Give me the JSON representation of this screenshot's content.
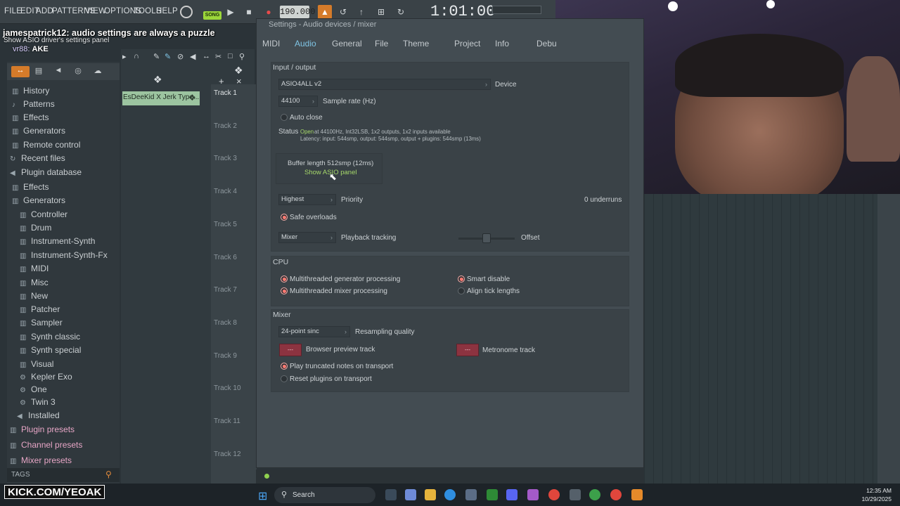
{
  "menu": [
    "FILE",
    "EDIT",
    "ADD",
    "PATTERNS",
    "VIEW",
    "OPTIONS",
    "TOOLS",
    "HELP"
  ],
  "transport": {
    "song_label": "SONG",
    "tempo": "190.000",
    "time": "1:01:00"
  },
  "chat": {
    "user": "jamespatrick12:",
    "message": "audio settings are always a puzzle",
    "second_user": "vr88:",
    "second_message": "AKE",
    "hint": "Show ASIO driver's settings panel"
  },
  "browser": {
    "items": [
      {
        "label": "History",
        "icon": "history-icon"
      },
      {
        "label": "Patterns",
        "icon": "note-icon"
      },
      {
        "label": "Effects",
        "icon": "speaker-icon"
      },
      {
        "label": "Generators",
        "icon": "piano-icon"
      },
      {
        "label": "Remote control",
        "icon": "remote-icon"
      },
      {
        "label": "Recent files",
        "icon": "refresh-icon"
      },
      {
        "label": "Plugin database",
        "icon": "plug-icon"
      },
      {
        "label": "Effects",
        "icon": "piano-icon"
      },
      {
        "label": "Generators",
        "icon": "piano-icon"
      },
      {
        "label": "Controller",
        "icon": "piano-icon"
      },
      {
        "label": "Drum",
        "icon": "piano-icon"
      },
      {
        "label": "Instrument-Synth",
        "icon": "piano-icon"
      },
      {
        "label": "Instrument-Synth-Fx",
        "icon": "piano-icon"
      },
      {
        "label": "MIDI",
        "icon": "piano-icon"
      },
      {
        "label": "Misc",
        "icon": "piano-icon"
      },
      {
        "label": "New",
        "icon": "piano-icon"
      },
      {
        "label": "Patcher",
        "icon": "piano-icon"
      },
      {
        "label": "Sampler",
        "icon": "piano-icon"
      },
      {
        "label": "Synth classic",
        "icon": "piano-icon"
      },
      {
        "label": "Synth special",
        "icon": "piano-icon"
      },
      {
        "label": "Visual",
        "icon": "piano-icon"
      },
      {
        "label": "Kepler Exo",
        "icon": "gear-icon"
      },
      {
        "label": "One",
        "icon": "gear-icon"
      },
      {
        "label": "Twin 3",
        "icon": "gear-icon"
      },
      {
        "label": "Installed",
        "icon": "plug-icon"
      },
      {
        "label": "Plugin presets",
        "icon": "preset-icon"
      },
      {
        "label": "Channel presets",
        "icon": "preset-icon"
      },
      {
        "label": "Mixer presets",
        "icon": "preset-icon"
      }
    ],
    "tags_label": "TAGS"
  },
  "channel_rack": {
    "channel_name": "EsDeeKid X Jerk Type..."
  },
  "playlist": {
    "tracks": [
      "Track 1",
      "Track 2",
      "Track 3",
      "Track 4",
      "Track 5",
      "Track 6",
      "Track 7",
      "Track 8",
      "Track 9",
      "Track 10",
      "Track 11",
      "Track 12"
    ]
  },
  "dialog": {
    "title": "Settings - Audio devices / mixer",
    "tabs": [
      "MIDI",
      "Audio",
      "General",
      "File",
      "Theme",
      "Project",
      "Info",
      "Debu"
    ],
    "io": {
      "section_title": "Input / output",
      "device_value": "ASIO4ALL v2",
      "device_label": "Device",
      "sample_rate_value": "44100",
      "sample_rate_label": "Sample rate (Hz)",
      "auto_close_label": "Auto close",
      "status_label": "Status",
      "status_open": "Open",
      "status_line1": "at 44100Hz, Int32LSB, 1x2 outputs, 1x2 inputs available",
      "status_line2": "Latency: input: 544smp, output: 544smp, output + plugins: 544smp (13ms)",
      "buffer_label": "Buffer length 512smp (12ms)",
      "asio_button": "Show ASIO panel",
      "priority_value": "Highest",
      "priority_label": "Priority",
      "underruns": "0 underruns",
      "safe_overloads": "Safe overloads",
      "tracking_value": "Mixer",
      "tracking_label": "Playback tracking",
      "offset_label": "Offset"
    },
    "cpu": {
      "section_title": "CPU",
      "multigen": "Multithreaded generator processing",
      "multimix": "Multithreaded mixer processing",
      "smart_disable": "Smart disable",
      "align_ticks": "Align tick lengths"
    },
    "mixer": {
      "section_title": "Mixer",
      "resampling_value": "24-point sinc",
      "resampling_label": "Resampling quality",
      "browser_track_value": "---",
      "browser_track_label": "Browser preview track",
      "metronome_value": "---",
      "metronome_label": "Metronome track",
      "play_truncated": "Play truncated notes on transport",
      "reset_plugins": "Reset plugins on transport"
    }
  },
  "stream": {
    "kick_label": "KICK.COM/YEOAK"
  },
  "taskbar": {
    "search_label": "Search",
    "time": "12:35 AM",
    "date": "10/29/2025"
  },
  "colors": {
    "accent_orange": "#d57b2a",
    "radio_on": "#e8625c",
    "link_green": "#a6d86a",
    "tab_active": "#7fc4e4"
  }
}
